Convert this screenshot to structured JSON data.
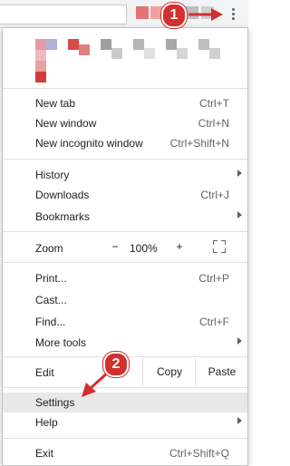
{
  "menu": {
    "new_section": [
      {
        "label": "New tab",
        "shortcut": "Ctrl+T"
      },
      {
        "label": "New window",
        "shortcut": "Ctrl+N"
      },
      {
        "label": "New incognito window",
        "shortcut": "Ctrl+Shift+N"
      }
    ],
    "history_section": [
      {
        "label": "History",
        "shortcut": ""
      },
      {
        "label": "Downloads",
        "shortcut": "Ctrl+J"
      },
      {
        "label": "Bookmarks",
        "shortcut": ""
      }
    ],
    "zoom": {
      "label": "Zoom",
      "minus": "−",
      "value": "100%",
      "plus": "+"
    },
    "print_section": [
      {
        "label": "Print...",
        "shortcut": "Ctrl+P"
      },
      {
        "label": "Cast...",
        "shortcut": ""
      },
      {
        "label": "Find...",
        "shortcut": "Ctrl+F"
      },
      {
        "label": "More tools",
        "shortcut": ""
      }
    ],
    "edit": {
      "label": "Edit",
      "cut": "",
      "copy": "Copy",
      "paste": "Paste"
    },
    "settings": {
      "label": "Settings"
    },
    "help": {
      "label": "Help"
    },
    "exit": {
      "label": "Exit",
      "shortcut": "Ctrl+Shift+Q"
    }
  },
  "annotations": {
    "badge1": "1",
    "badge2": "2"
  },
  "colors": {
    "annotation_red": "#d32f2f",
    "highlight": "#e8e8e8"
  }
}
